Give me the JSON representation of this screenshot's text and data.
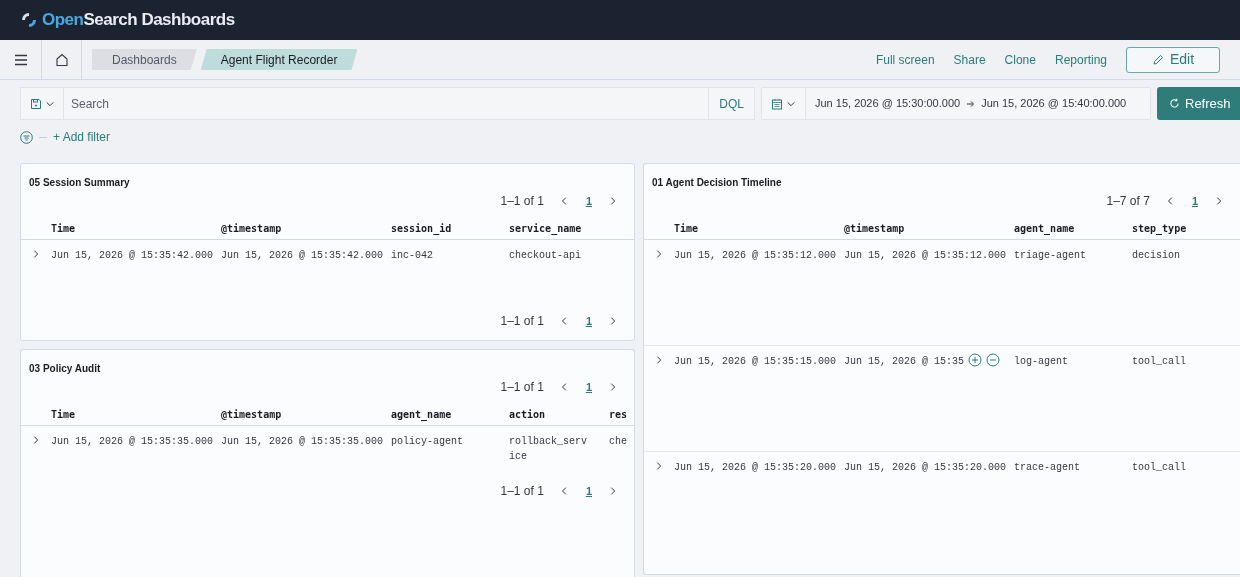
{
  "header": {
    "logo_accent": "Open",
    "logo_rest": "Search Dashboards"
  },
  "breadcrumbs": [
    {
      "label": "Dashboards",
      "selected": false
    },
    {
      "label": "Agent Flight Recorder",
      "selected": true
    }
  ],
  "top_links": [
    "Full screen",
    "Share",
    "Clone",
    "Reporting"
  ],
  "edit_button": "Edit",
  "query": {
    "placeholder": "Search",
    "language": "DQL",
    "start": "Jun 15, 2026 @ 15:30:00.000",
    "end": "Jun 15, 2026 @ 15:40:00.000",
    "refresh": "Refresh"
  },
  "add_filter": "+ Add filter",
  "left_panels": [
    {
      "title": "05 Session Summary",
      "pagination_top": {
        "summary": "1–1 of 1",
        "page": "1"
      },
      "pagination_bottom": {
        "summary": "1–1 of 1",
        "page": "1"
      },
      "columns": [
        "Time",
        "@timestamp",
        "session_id",
        "service_name"
      ],
      "rows": [
        {
          "cells": [
            "Jun 15, 2026 @ 15:35:42.000",
            "Jun 15, 2026 @ 15:35:42.000",
            "inc-042",
            "checkout-api"
          ],
          "hovered": false
        }
      ]
    },
    {
      "title": "03 Policy Audit",
      "pagination_top": {
        "summary": "1–1 of 1",
        "page": "1"
      },
      "pagination_bottom": {
        "summary": "1–1 of 1",
        "page": "1"
      },
      "columns": [
        "Time",
        "@timestamp",
        "agent_name",
        "action",
        "res"
      ],
      "rows": [
        {
          "cells": [
            "Jun 15, 2026 @ 15:35:35.000",
            "Jun 15, 2026 @ 15:35:35.000",
            "policy-agent",
            "rollback_service",
            "che"
          ],
          "hovered": false
        }
      ]
    }
  ],
  "right_panels": [
    {
      "title": "01 Agent Decision Timeline",
      "pagination_top": {
        "summary": "1–7 of 7",
        "page": "1"
      },
      "columns": [
        "Time",
        "@timestamp",
        "agent_name",
        "step_type"
      ],
      "rows": [
        {
          "cells": [
            "Jun 15, 2026 @ 15:35:12.000",
            "Jun 15, 2026 @ 15:35:12.000",
            "triage-agent",
            "decision"
          ],
          "hovered": false
        },
        {
          "cells": [
            "Jun 15, 2026 @ 15:35:15.000",
            "Jun 15, 2026 @ 15:35",
            "log-agent",
            "tool_call"
          ],
          "hovered": true
        },
        {
          "cells": [
            "Jun 15, 2026 @ 15:35:20.000",
            "Jun 15, 2026 @ 15:35:20.000",
            "trace-agent",
            "tool_call"
          ],
          "hovered": false
        }
      ]
    }
  ]
}
